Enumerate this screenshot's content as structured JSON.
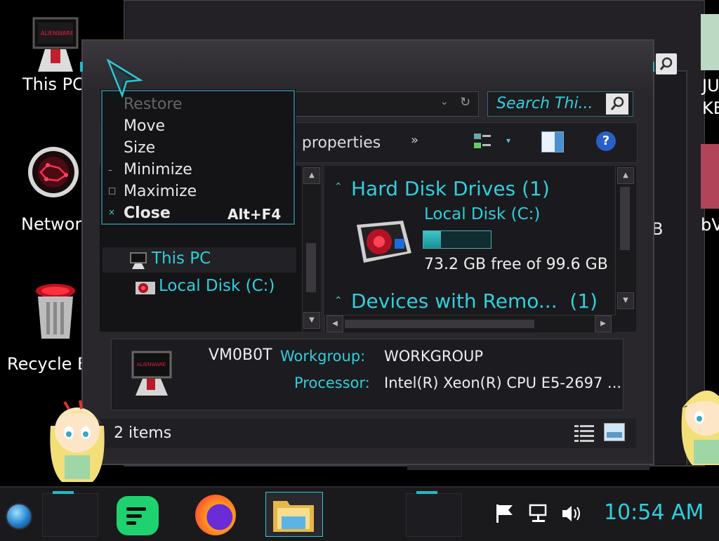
{
  "desktop": {
    "icons": [
      {
        "label": "This PC",
        "icon": "alienware-monitor-icon"
      },
      {
        "label": "Network",
        "icon": "network-orb-icon"
      },
      {
        "label": "Recycle Bin",
        "icon": "recycle-bin-icon"
      }
    ],
    "right_fragments": [
      "JU",
      "KE",
      "bV"
    ]
  },
  "explorer": {
    "search_placeholder": "Search Thi...",
    "toolbar": {
      "system_properties": "n properties",
      "overflow": "»"
    },
    "nav_tree": [
      {
        "label": "This PC",
        "icon": "alienware-pc-icon",
        "selected": true
      },
      {
        "label": "Local Disk (C:)",
        "icon": "disk-drive-icon",
        "selected": false
      }
    ],
    "groups": [
      {
        "title": "Hard Disk Drives (1)"
      },
      {
        "title": "Devices with Remo...  (1)"
      }
    ],
    "drive": {
      "name": "Local Disk (C:)",
      "free_text": "73.2 GB free of 99.6 GB",
      "used_fraction": 0.265
    },
    "details": {
      "computer_name": "VM0B0T",
      "workgroup_label": "Workgroup:",
      "workgroup_value": "WORKGROUP",
      "processor_label": "Processor:",
      "processor_value": "Intel(R) Xeon(R) CPU E5-2697 ..."
    },
    "status": {
      "items_count": "2 items"
    },
    "behind_text": "B"
  },
  "context_menu": {
    "items": [
      {
        "label": "Restore",
        "disabled": true,
        "glyph": ""
      },
      {
        "label": "Move",
        "disabled": false,
        "glyph": ""
      },
      {
        "label": "Size",
        "disabled": false,
        "glyph": ""
      },
      {
        "label": "Minimize",
        "disabled": false,
        "glyph": "–"
      },
      {
        "label": "Maximize",
        "disabled": false,
        "glyph": "□"
      },
      {
        "label": "Close",
        "disabled": false,
        "glyph": "×",
        "shortcut": "Alt+F4"
      }
    ]
  },
  "taskbar": {
    "clock": "10:54 AM",
    "pinned": [
      "start-orb-icon",
      "notes-app-icon",
      "firefox-icon",
      "file-explorer-icon"
    ],
    "tray": [
      "action-center-flag-icon",
      "network-icon",
      "volume-icon"
    ]
  },
  "colors": {
    "accent": "#2fd0dc",
    "background": "#000000",
    "window": "#29272c"
  }
}
